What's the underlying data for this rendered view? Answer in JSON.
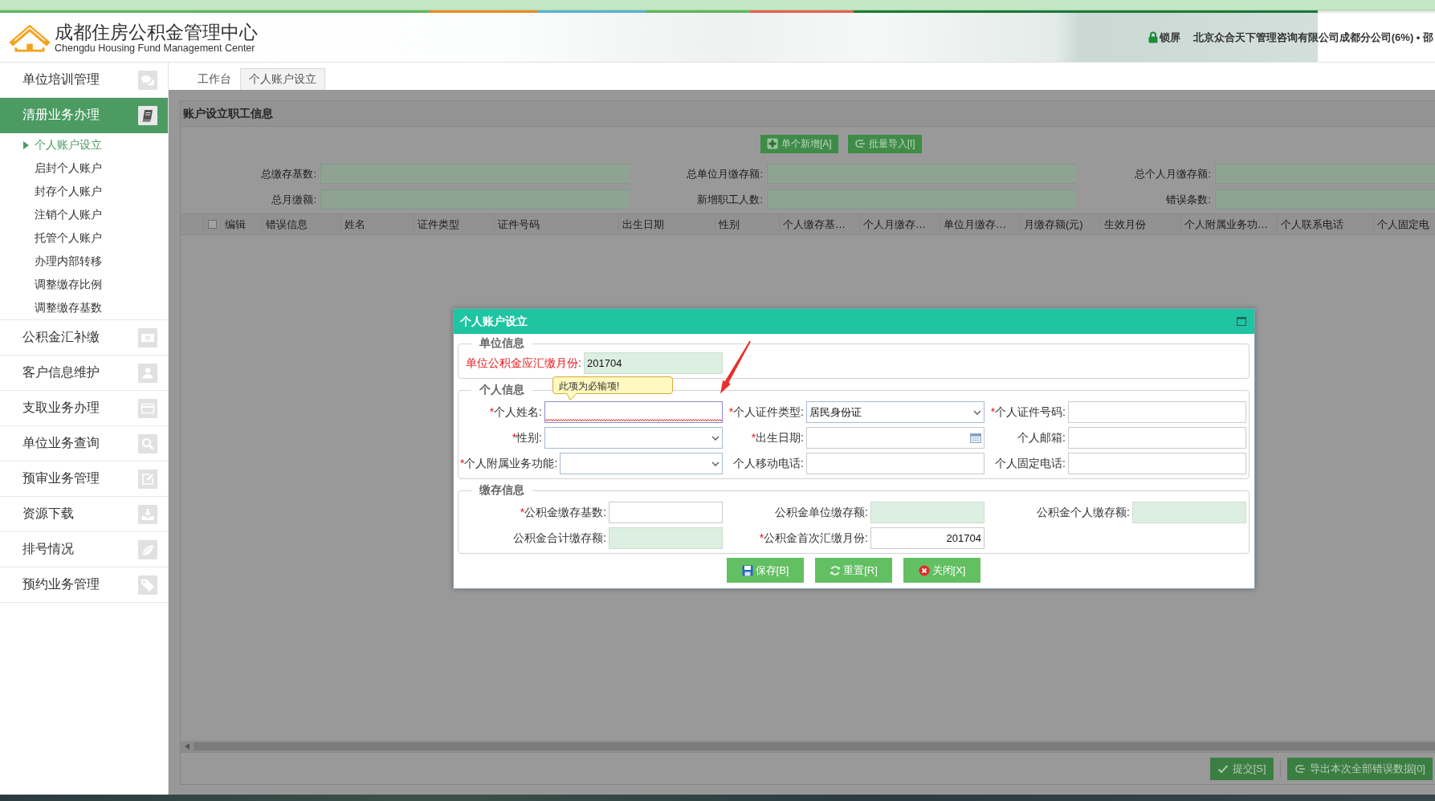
{
  "header": {
    "title": "成都住房公积金管理中心",
    "subtitle": "Chengdu Housing Fund Management Center",
    "lock_label": "锁屏",
    "user_info": "北京众合天下管理咨询有限公司成都分公司(6%) • 邵"
  },
  "sidebar": {
    "items": [
      {
        "label": "单位培训管理",
        "selected": false
      },
      {
        "label": "清册业务办理",
        "selected": true,
        "children": [
          {
            "label": "个人账户设立",
            "selected": true
          },
          {
            "label": "启封个人账户",
            "selected": false
          },
          {
            "label": "封存个人账户",
            "selected": false
          },
          {
            "label": "注销个人账户",
            "selected": false
          },
          {
            "label": "托管个人账户",
            "selected": false
          },
          {
            "label": "办理内部转移",
            "selected": false
          },
          {
            "label": "调整缴存比例",
            "selected": false
          },
          {
            "label": "调整缴存基数",
            "selected": false
          }
        ]
      },
      {
        "label": "公积金汇补缴",
        "selected": false
      },
      {
        "label": "客户信息维护",
        "selected": false
      },
      {
        "label": "支取业务办理",
        "selected": false
      },
      {
        "label": "单位业务查询",
        "selected": false
      },
      {
        "label": "预审业务管理",
        "selected": false
      },
      {
        "label": "资源下载",
        "selected": false
      },
      {
        "label": "排号情况",
        "selected": false
      },
      {
        "label": "预约业务管理",
        "selected": false
      }
    ]
  },
  "tabs": [
    {
      "label": "工作台",
      "selected": false
    },
    {
      "label": "个人账户设立",
      "selected": true
    }
  ],
  "panel": {
    "title": "账户设立职工信息",
    "toolbar": [
      "单个新增[A]",
      "批量导入[I]"
    ],
    "summary": [
      {
        "label": "总缴存基数:"
      },
      {
        "label": "总单位月缴存额:"
      },
      {
        "label": "总个人月缴存额:"
      },
      {
        "label": "总月缴额:"
      },
      {
        "label": "新增职工人数:"
      },
      {
        "label": "错误条数:"
      }
    ],
    "table": {
      "select_all": {
        "checked": false
      },
      "columns": [
        "编辑",
        "错误信息",
        "姓名",
        "证件类型",
        "证件号码",
        "出生日期",
        "性别",
        "个人缴存基…",
        "个人月缴存…",
        "单位月缴存…",
        "月缴存额(元)",
        "生效月份",
        "个人附属业务功…",
        "个人联系电话",
        "个人固定电"
      ]
    },
    "footer_buttons": [
      "提交[S]",
      "导出本次全部错误数据[0]"
    ]
  },
  "dialog": {
    "title": "个人账户设立",
    "sections": [
      {
        "legend": "单位信息",
        "rows": [
          [
            {
              "label": "单位公积金应汇缴月份:",
              "alert": true,
              "kind": "text",
              "readonly": true,
              "invalid": false,
              "value": "201704"
            }
          ]
        ]
      },
      {
        "legend": "个人信息",
        "rows": [
          [
            {
              "mark": "*",
              "label": "个人姓名:",
              "alert": false,
              "kind": "text",
              "readonly": false,
              "invalid": true,
              "error_tip": "此项为必输项!"
            },
            {
              "mark": "*",
              "label": "个人证件类型:",
              "alert": false,
              "kind": "select",
              "readonly": false,
              "invalid": false,
              "value": "居民身份证"
            },
            {
              "mark": "*",
              "label": "个人证件号码:",
              "alert": false,
              "kind": "text",
              "readonly": false,
              "invalid": false
            }
          ],
          [
            {
              "mark": "*",
              "label": "性别:",
              "alert": false,
              "kind": "select",
              "readonly": false,
              "invalid": false
            },
            {
              "mark": "*",
              "label": "出生日期:",
              "alert": false,
              "kind": "date",
              "readonly": false,
              "invalid": false
            },
            {
              "label": "个人邮箱:",
              "alert": false,
              "kind": "text",
              "readonly": false,
              "invalid": false
            }
          ],
          [
            {
              "mark": "*",
              "label": "个人附属业务功能:",
              "alert": false,
              "kind": "select",
              "readonly": false,
              "invalid": false
            },
            {
              "label": "个人移动电话:",
              "alert": false,
              "kind": "text",
              "readonly": false,
              "invalid": false
            },
            {
              "label": "个人固定电话:",
              "alert": false,
              "kind": "text",
              "readonly": false,
              "invalid": false
            }
          ]
        ]
      },
      {
        "legend": "缴存信息",
        "rows": [
          [
            {
              "mark": "*",
              "label": "公积金缴存基数:",
              "alert": false,
              "kind": "text",
              "readonly": false,
              "invalid": false
            },
            {
              "label": "公积金单位缴存额:",
              "alert": false,
              "kind": "text",
              "readonly": true,
              "invalid": false
            },
            {
              "label": "公积金个人缴存额:",
              "alert": false,
              "kind": "text",
              "readonly": true,
              "invalid": false
            }
          ],
          [
            {
              "label": "公积金合计缴存额:",
              "alert": false,
              "kind": "text",
              "readonly": true,
              "invalid": false
            },
            {
              "mark": "*",
              "label": "公积金首次汇缴月份:",
              "alert": false,
              "kind": "text",
              "readonly": false,
              "invalid": false,
              "value": "201704"
            }
          ]
        ]
      }
    ],
    "buttons": [
      "保存[B]",
      "重置[R]",
      "关闭[X]"
    ]
  }
}
